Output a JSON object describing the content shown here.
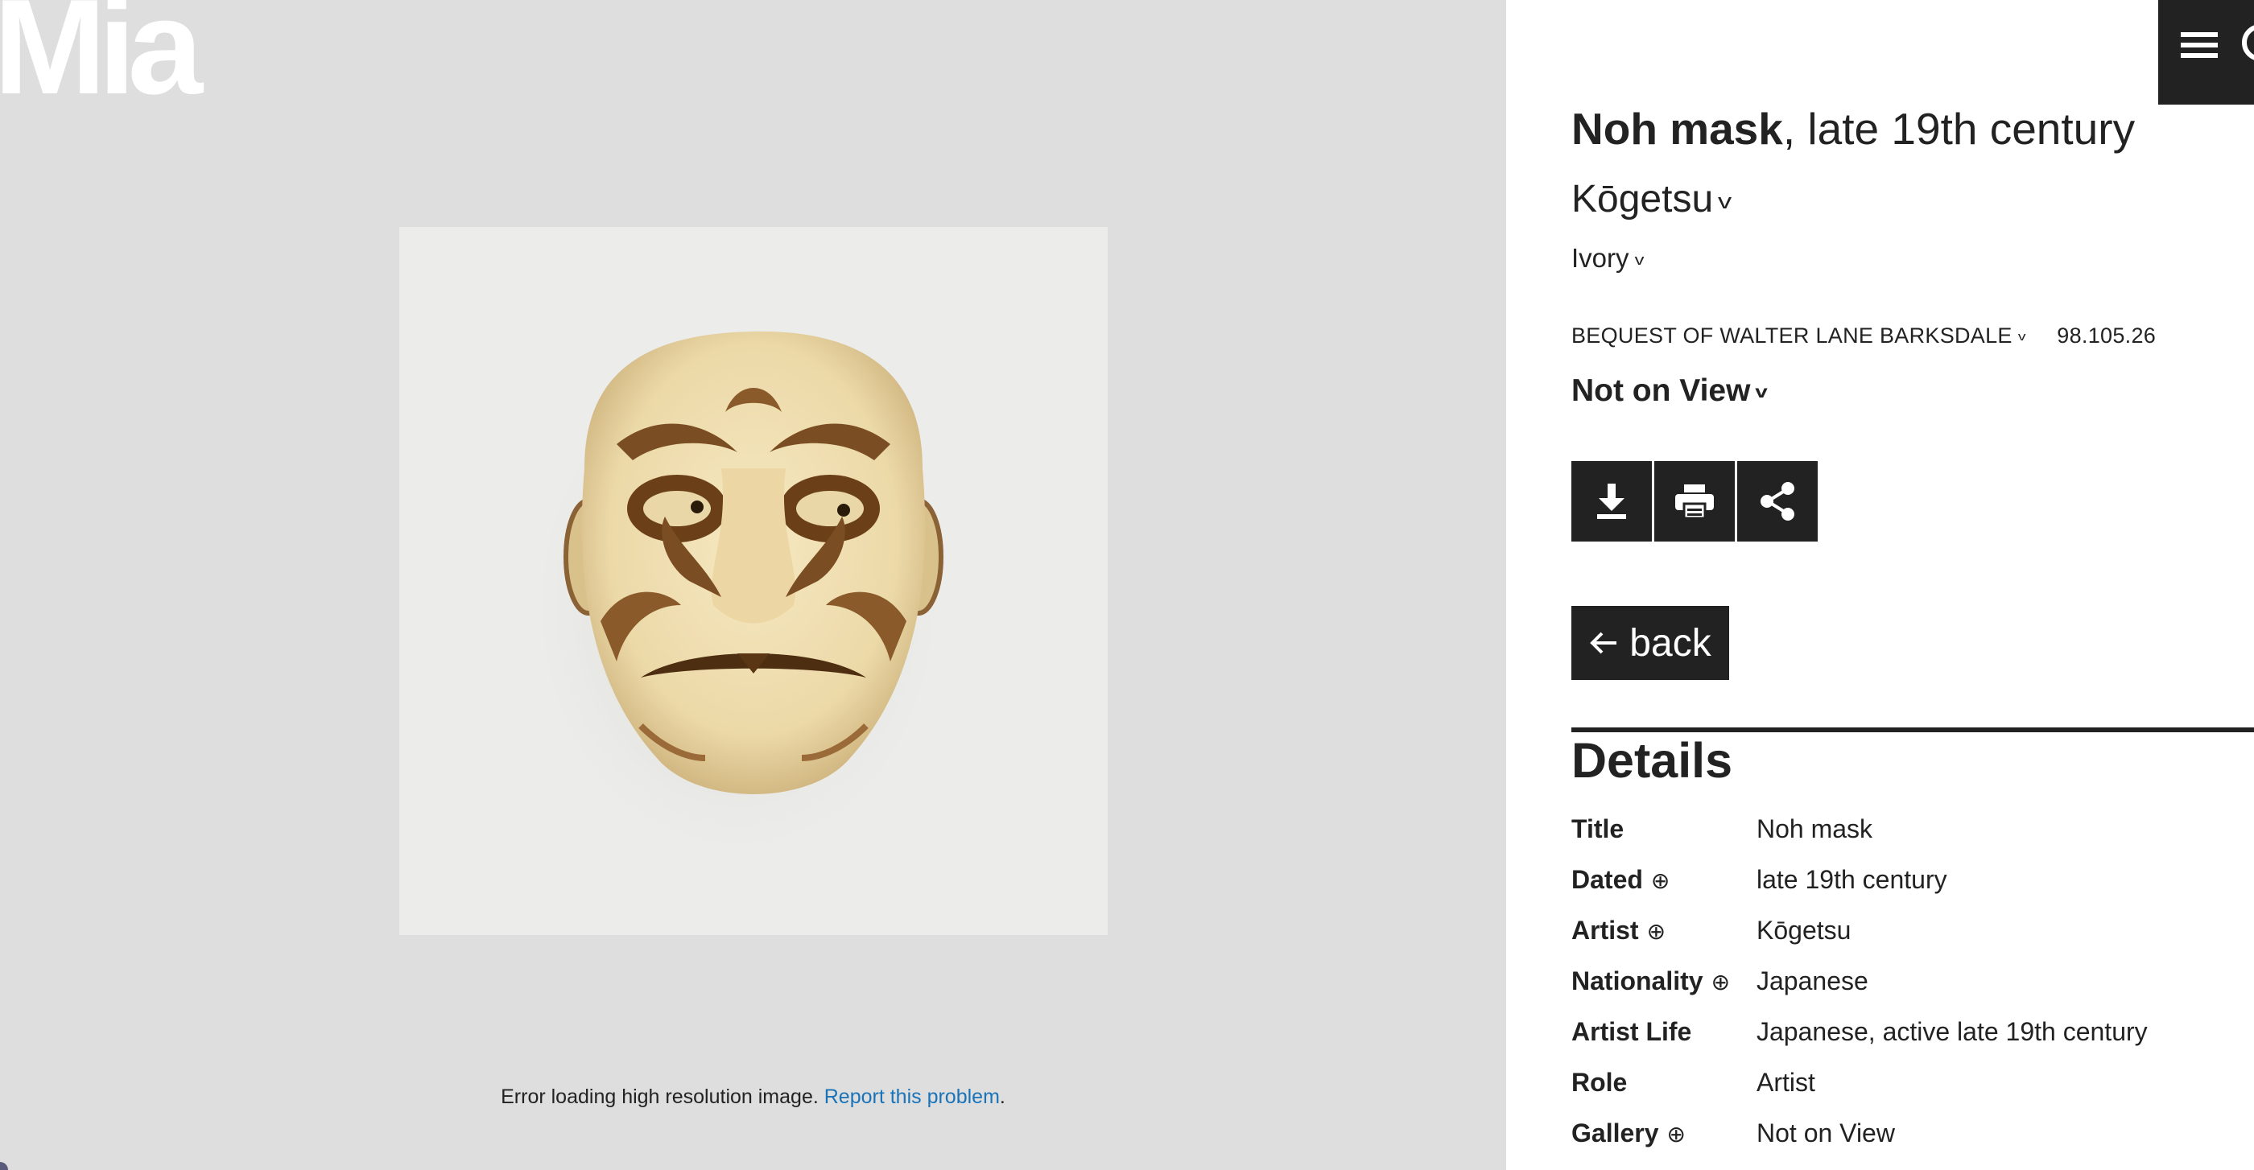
{
  "logo": {
    "text": "Mia"
  },
  "viewer": {
    "error_text": "Error loading high resolution image.",
    "report_link": "Report this problem",
    "error_end": "."
  },
  "header": {
    "menu_icon": "hamburger-icon",
    "search_icon": "search-icon"
  },
  "artwork": {
    "title": "Noh mask",
    "date_suffix": ", late 19th century",
    "artist": "Kōgetsu",
    "medium": "Ivory",
    "credit": "BEQUEST OF WALTER LANE BARKSDALE",
    "accession": "98.105.26",
    "status": "Not on View"
  },
  "actions": {
    "download_icon": "download-icon",
    "print_icon": "print-icon",
    "share_icon": "share-icon",
    "back_label": "back"
  },
  "details": {
    "heading": "Details",
    "rows": [
      {
        "key": "Title",
        "value": "Noh mask",
        "expand": false
      },
      {
        "key": "Dated",
        "value": "late 19th century",
        "expand": true
      },
      {
        "key": "Artist",
        "value": "Kōgetsu",
        "expand": true
      },
      {
        "key": "Nationality",
        "value": "Japanese",
        "expand": true
      },
      {
        "key": "Artist Life",
        "value": "Japanese, active late 19th century",
        "expand": false
      },
      {
        "key": "Role",
        "value": "Artist",
        "expand": false
      },
      {
        "key": "Gallery",
        "value": "Not on View",
        "expand": true
      }
    ],
    "expand_glyph": "⊕"
  },
  "colors": {
    "dark": "#222222",
    "viewer_bg": "#dedede",
    "link": "#1a73b8"
  }
}
